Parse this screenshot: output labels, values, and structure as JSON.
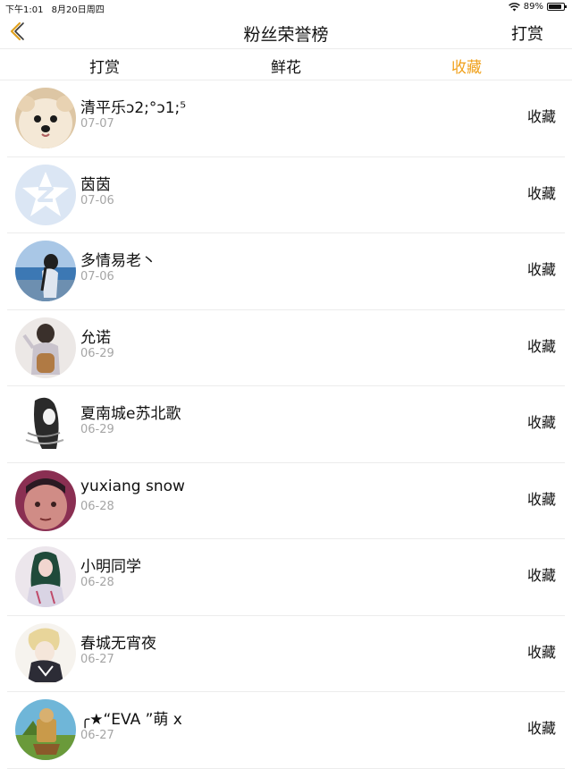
{
  "status": {
    "time": "下午1:01",
    "date": "8月20日周四",
    "battery_percent": "89%",
    "battery_level": 0.89
  },
  "nav": {
    "title": "粉丝荣誉榜",
    "action": "打赏"
  },
  "tabs": [
    {
      "label": "打赏",
      "active": false
    },
    {
      "label": "鲜花",
      "active": false
    },
    {
      "label": "收藏",
      "active": true
    }
  ],
  "colors": {
    "accent": "#f0a11c",
    "divider": "#ececec",
    "date_text": "#a5a5a5"
  },
  "rows": [
    {
      "name": "清平乐ↄ2;°ↄ1;⁵",
      "date": "07-07",
      "action": "收藏",
      "avatar": "dog-avatar"
    },
    {
      "name": "茵茵",
      "date": "07-06",
      "action": "收藏",
      "avatar": "qq-default-avatar"
    },
    {
      "name": "多情易老丶",
      "date": "07-06",
      "action": "收藏",
      "avatar": "girl-sea-avatar"
    },
    {
      "name": "允诺",
      "date": "06-29",
      "action": "收藏",
      "avatar": "girl-backpack-avatar"
    },
    {
      "name": "夏南城e苏北歌",
      "date": "06-29",
      "action": "收藏",
      "avatar": "sketch-girl-avatar"
    },
    {
      "name": "yuxiang snow",
      "date": "06-28",
      "action": "收藏",
      "avatar": "man-selfie-avatar"
    },
    {
      "name": "小明同学",
      "date": "06-28",
      "action": "收藏",
      "avatar": "girl-green-hair-avatar"
    },
    {
      "name": "春城无宵夜",
      "date": "06-27",
      "action": "收藏",
      "avatar": "anime-avatar"
    },
    {
      "name": "╭★“EVA ”萌 x",
      "date": "06-27",
      "action": "收藏",
      "avatar": "cartoon-landscape-avatar"
    }
  ]
}
